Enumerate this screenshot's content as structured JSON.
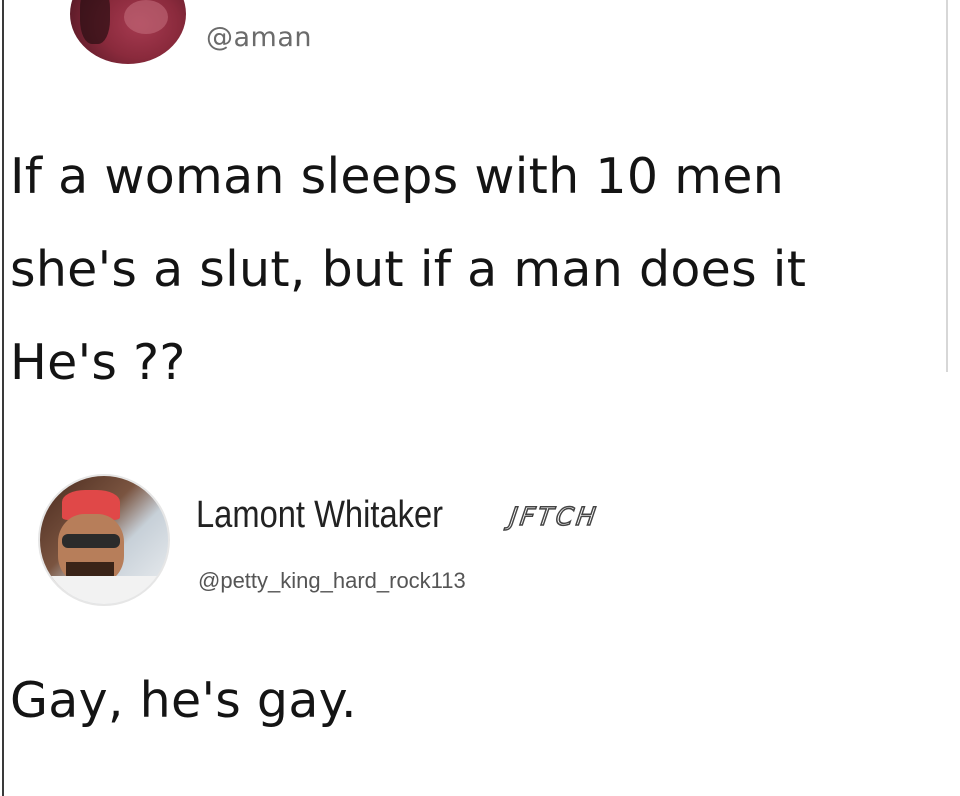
{
  "tweet": {
    "handle": "@aman",
    "text_lines": [
      "If a woman sleeps with 10 men",
      "she's a slut, but if a man does it",
      "He's ??"
    ],
    "avatar_icon": "profile-photo-icon"
  },
  "reply": {
    "display_name": "Lamont Whitaker",
    "watermark": "JFTCH",
    "handle": "@petty_king_hard_rock113",
    "text": "Gay, he's gay.",
    "avatar_icon": "profile-photo-icon"
  }
}
